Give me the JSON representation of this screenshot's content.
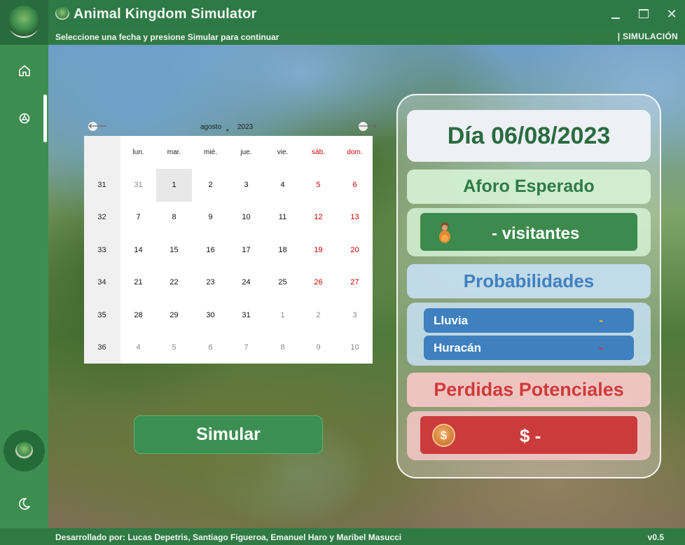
{
  "window": {
    "title": "Animal Kingdom Simulator",
    "minimize_icon": "minimize-icon",
    "maximize_icon": "maximize-icon",
    "close_glyph": "✕"
  },
  "subbar": {
    "instruction": "Seleccione una fecha y presione Simular para continuar",
    "mode": "| SIMULACIÓN"
  },
  "sidebar": {
    "items": [
      {
        "name": "home",
        "icon": "home-icon"
      },
      {
        "name": "simulation",
        "icon": "settings-icon",
        "active": true
      }
    ],
    "bottom_icon": "moon-icon"
  },
  "calendar": {
    "prev_glyph": "🡐",
    "next_glyph": "🡒",
    "month": "agosto",
    "year": "2023",
    "headers": [
      "lun.",
      "mar.",
      "mié.",
      "jue.",
      "vie.",
      "sáb.",
      "dom."
    ],
    "weeks": [
      {
        "num": "31",
        "days": [
          "31",
          "1",
          "2",
          "3",
          "4",
          "5",
          "6"
        ]
      },
      {
        "num": "32",
        "days": [
          "7",
          "8",
          "9",
          "10",
          "11",
          "12",
          "13"
        ]
      },
      {
        "num": "33",
        "days": [
          "14",
          "15",
          "16",
          "17",
          "18",
          "19",
          "20"
        ]
      },
      {
        "num": "34",
        "days": [
          "21",
          "22",
          "23",
          "24",
          "25",
          "26",
          "27"
        ]
      },
      {
        "num": "35",
        "days": [
          "28",
          "29",
          "30",
          "31",
          "1",
          "2",
          "3"
        ]
      },
      {
        "num": "36",
        "days": [
          "4",
          "5",
          "6",
          "7",
          "8",
          "9",
          "10"
        ]
      }
    ],
    "selected_day": "1",
    "weekend_color": "#d00000",
    "other_month_color": "#8a8a8a"
  },
  "simulate_button": "Simular",
  "results": {
    "date_label": "Día 06/08/2023",
    "aforo_title": "Aforo Esperado",
    "visitors_value": "- visitantes",
    "prob_title": "Probabilidades",
    "prob_rows": [
      {
        "label": "Lluvia",
        "value": "-",
        "value_color": "#f0b43c"
      },
      {
        "label": "Huracán",
        "value": "-",
        "value_color": "#e02a2a"
      }
    ],
    "loss_title": "Perdidas Potenciales",
    "loss_value": "$ -",
    "coin_glyph": "$"
  },
  "footer": {
    "credits": "Desarrollado por: Lucas Depetris, Santiago Figueroa, Emanuel Haro y Maribel Masucci",
    "version": "v0.5"
  },
  "colors": {
    "brand_green": "#2e7a46",
    "panel_green": "#3c8a4d",
    "panel_blue": "#3f80c0",
    "panel_red": "#cc3b3b"
  }
}
